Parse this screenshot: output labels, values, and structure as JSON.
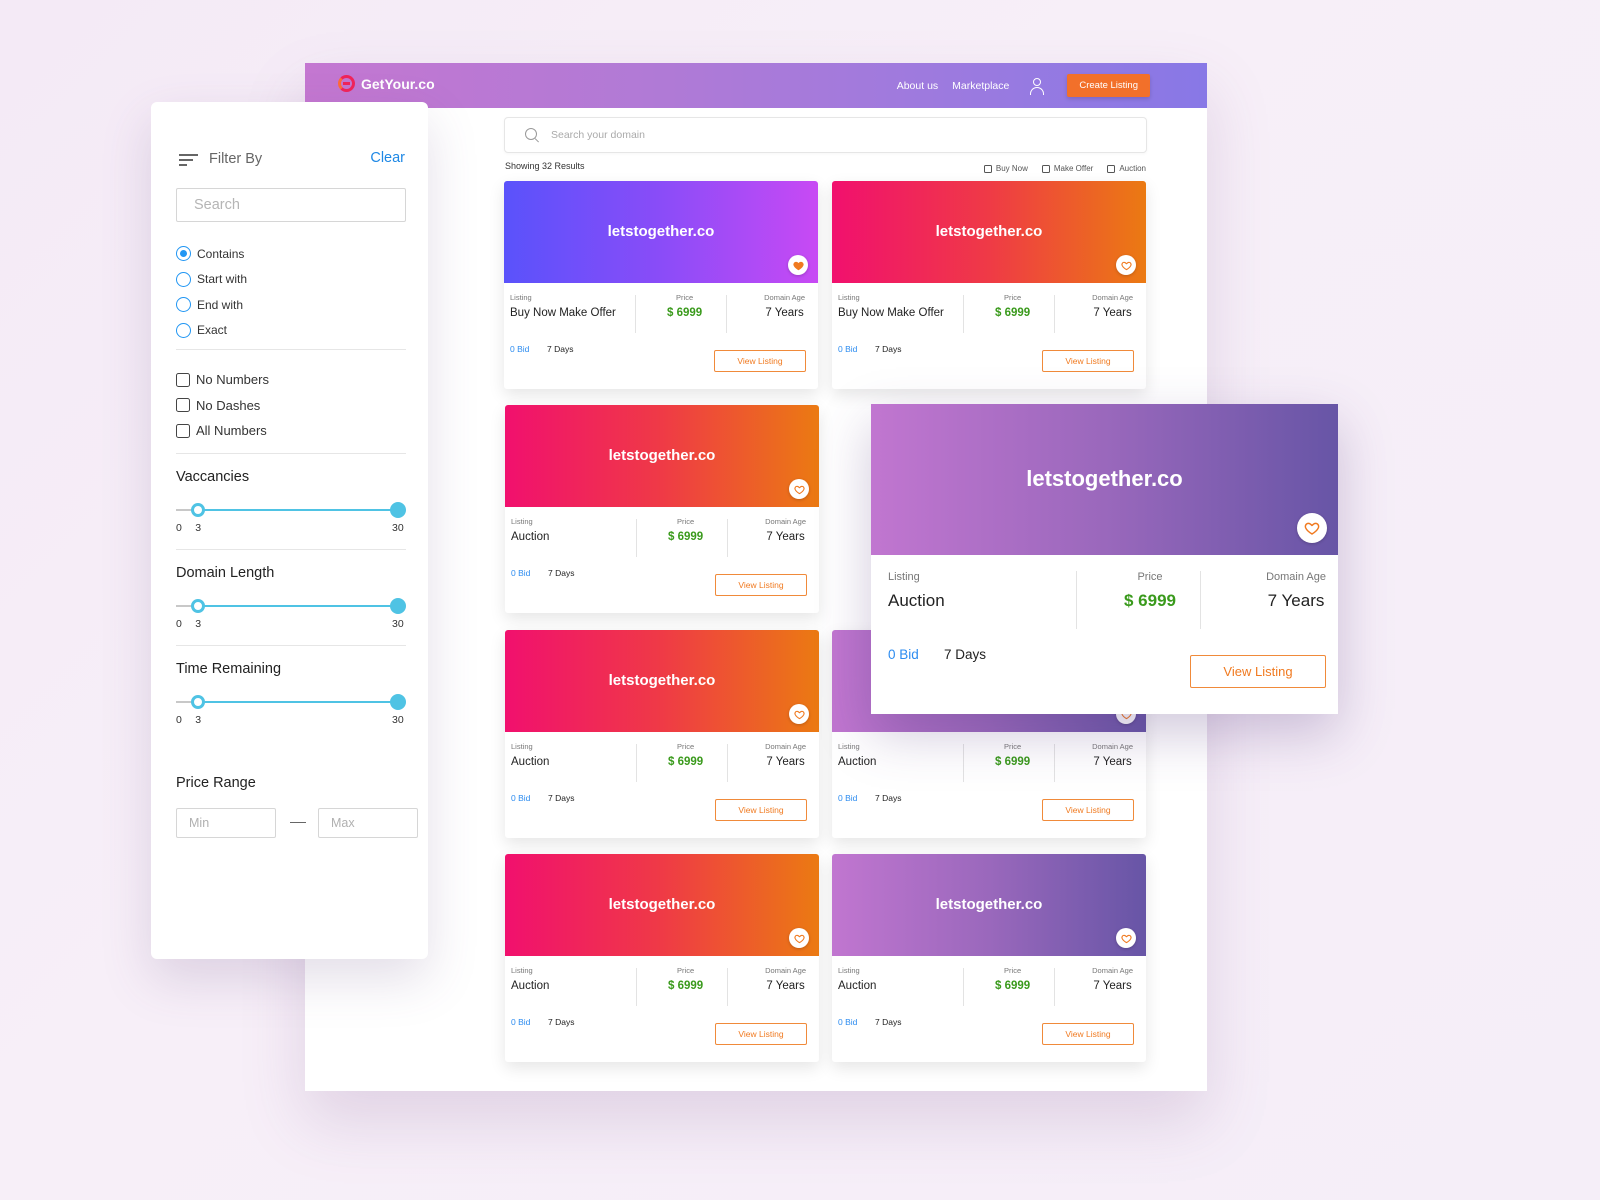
{
  "navbar": {
    "brand": "GetYour.co",
    "links": [
      "About us",
      "Marketplace"
    ],
    "create_listing": "Create Listing"
  },
  "search": {
    "placeholder": "Search your domain",
    "value": ""
  },
  "results": {
    "count_text": "Showing 32 Results",
    "type_filters": [
      {
        "label": "Buy Now",
        "checked": false
      },
      {
        "label": "Make Offer",
        "checked": false
      },
      {
        "label": "Auction",
        "checked": false
      }
    ]
  },
  "card_labels": {
    "listing": "Listing",
    "price": "Price",
    "domain_age": "Domain Age",
    "view_button": "View Listing"
  },
  "colors": {
    "accent_orange": "#f2702a",
    "price_green": "#3a9a1c",
    "bid_blue": "#2d8cf0",
    "slider_cyan": "#4fc3e4",
    "link_blue": "#1e88e5"
  },
  "listings": [
    {
      "domain": "letstogether.co",
      "listing": "Buy Now Make Offer",
      "price": "$ 6999",
      "age": "7 Years",
      "bids": "0 Bid",
      "time_left": "7 Days",
      "favorited": true,
      "theme": "blue"
    },
    {
      "domain": "letstogether.co",
      "listing": "Buy Now Make Offer",
      "price": "$ 6999",
      "age": "7 Years",
      "bids": "0 Bid",
      "time_left": "7 Days",
      "favorited": false,
      "theme": "red"
    },
    {
      "domain": "letstogether.co",
      "listing": "Auction",
      "price": "$ 6999",
      "age": "7 Years",
      "bids": "0 Bid",
      "time_left": "7 Days",
      "favorited": false,
      "theme": "red"
    },
    {
      "domain": "letstogether.co",
      "listing": "Auction",
      "price": "$ 6999",
      "age": "7 Years",
      "bids": "0 Bid",
      "time_left": "7 Days",
      "favorited": false,
      "theme": "purple"
    },
    {
      "domain": "letstogether.co",
      "listing": "Auction",
      "price": "$ 6999",
      "age": "7 Years",
      "bids": "0 Bid",
      "time_left": "7 Days",
      "favorited": false,
      "theme": "red"
    },
    {
      "domain": "letstogether.co",
      "listing": "Auction",
      "price": "$ 6999",
      "age": "7 Years",
      "bids": "0 Bid",
      "time_left": "7 Days",
      "favorited": false,
      "theme": "purple"
    },
    {
      "domain": "letstogether.co",
      "listing": "Auction",
      "price": "$ 6999",
      "age": "7 Years",
      "bids": "0 Bid",
      "time_left": "7 Days",
      "favorited": false,
      "theme": "red"
    },
    {
      "domain": "letstogether.co",
      "listing": "Auction",
      "price": "$ 6999",
      "age": "7 Years",
      "bids": "0 Bid",
      "time_left": "7 Days",
      "favorited": false,
      "theme": "purple"
    }
  ],
  "featured_card": {
    "domain": "letstogether.co",
    "listing": "Auction",
    "price": "$ 6999",
    "age": "7 Years",
    "bids": "0 Bid",
    "time_left": "7 Days",
    "favorited": false
  },
  "filter": {
    "title": "Filter By",
    "clear": "Clear",
    "search_placeholder": "Search",
    "match_modes": [
      {
        "label": "Contains",
        "selected": true
      },
      {
        "label": "Start with",
        "selected": false
      },
      {
        "label": "End with",
        "selected": false
      },
      {
        "label": "Exact",
        "selected": false
      }
    ],
    "options": [
      {
        "label": "No Numbers",
        "checked": false
      },
      {
        "label": "No Dashes",
        "checked": false
      },
      {
        "label": "All Numbers",
        "checked": false
      }
    ],
    "sliders": [
      {
        "title": "Vaccancies",
        "min": 0,
        "max": 30,
        "low": 3,
        "high": 30,
        "tick_min": "0",
        "tick_low": "3",
        "tick_max": "30"
      },
      {
        "title": "Domain Length",
        "min": 0,
        "max": 30,
        "low": 3,
        "high": 30,
        "tick_min": "0",
        "tick_low": "3",
        "tick_max": "30"
      },
      {
        "title": "Time Remaining",
        "min": 0,
        "max": 30,
        "low": 3,
        "high": 30,
        "tick_min": "0",
        "tick_low": "3",
        "tick_max": "30"
      }
    ],
    "price_range": {
      "title": "Price Range",
      "min_placeholder": "Min",
      "max_placeholder": "Max"
    }
  }
}
